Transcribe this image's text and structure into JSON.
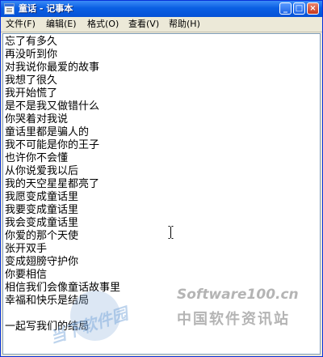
{
  "window": {
    "title": "童话 - 记事本",
    "minimize_glyph": "_",
    "maximize_glyph": "□",
    "close_glyph": "×"
  },
  "menu": [
    {
      "label": "文件(F)"
    },
    {
      "label": "编辑(E)"
    },
    {
      "label": "格式(O)"
    },
    {
      "label": "查看(V)"
    },
    {
      "label": "帮助(H)"
    }
  ],
  "editor": {
    "lines": [
      "忘了有多久",
      "再没听到你",
      "对我说你最爱的故事",
      "我想了很久",
      "我开始慌了",
      "是不是我又做错什么",
      "你哭着对我说",
      "童话里都是骗人的",
      "我不可能是你的王子",
      "也许你不会懂",
      "从你说爱我以后",
      "我的天空星星都亮了",
      "我愿变成童话里",
      "我要变成童话里",
      "我会变成童话里",
      "你爱的那个天使",
      "张开双手",
      "变成翅膀守护你",
      "你要相信",
      "相信我们会像童话故事里",
      "幸福和快乐是结局",
      "",
      "一起写我们的结局"
    ]
  },
  "watermark": {
    "brand": "Software100.cn",
    "cn": "中国软件资讯站",
    "circle_text": "当下软件园"
  }
}
